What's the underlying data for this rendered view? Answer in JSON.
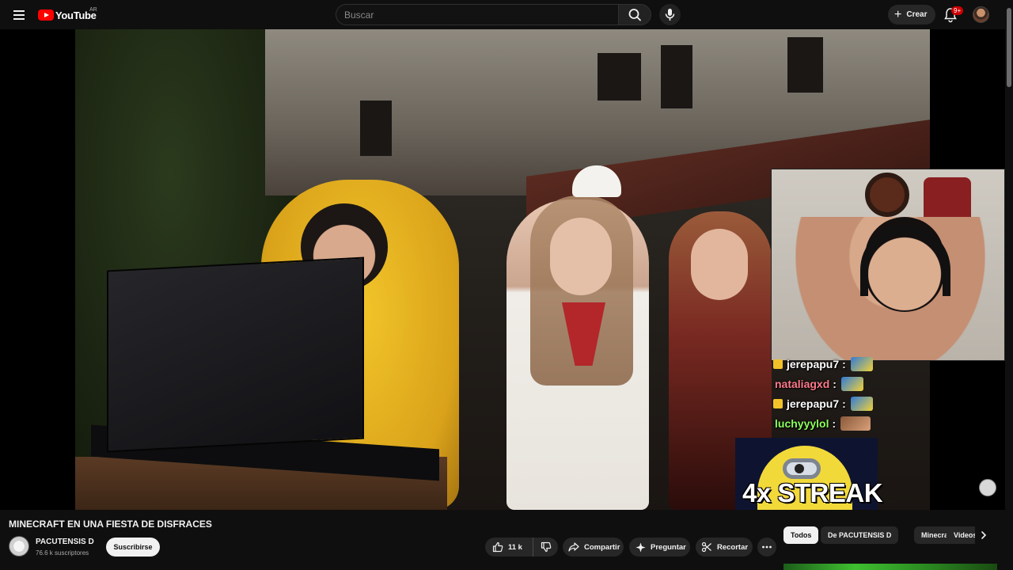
{
  "topbar": {
    "logo_text": "YouTube",
    "country_code": "AR",
    "search_placeholder": "Buscar",
    "create_label": "Crear",
    "notifications_badge": "9+"
  },
  "player": {
    "chat": [
      {
        "user": "jerepapu7",
        "badge": true,
        "color": "#ffffff"
      },
      {
        "user": "nataliagxd",
        "badge": false,
        "color": "#ff7a8a"
      },
      {
        "user": "jerepapu7",
        "badge": true,
        "color": "#ffffff"
      },
      {
        "user": "luchyyylol",
        "badge": false,
        "color": "#8cff5a"
      }
    ],
    "overlay_text": "4x STREAK"
  },
  "video": {
    "title": "MINECRAFT EN UNA FIESTA DE DISFRACES",
    "channel_name": "PACUTENSIS D",
    "subscribers": "76.6 k suscriptores",
    "subscribe_label": "Suscribirse",
    "likes": "11 k",
    "share_label": "Compartir",
    "ask_label": "Preguntar",
    "clip_label": "Recortar"
  },
  "chips": [
    "Todos",
    "De PACUTENSIS D",
    "Minecraft",
    "Videos"
  ],
  "colors": {
    "background": "#0f0f0f",
    "pill": "#272727",
    "brand_red": "#ff0000",
    "badge_red": "#cc0000"
  }
}
